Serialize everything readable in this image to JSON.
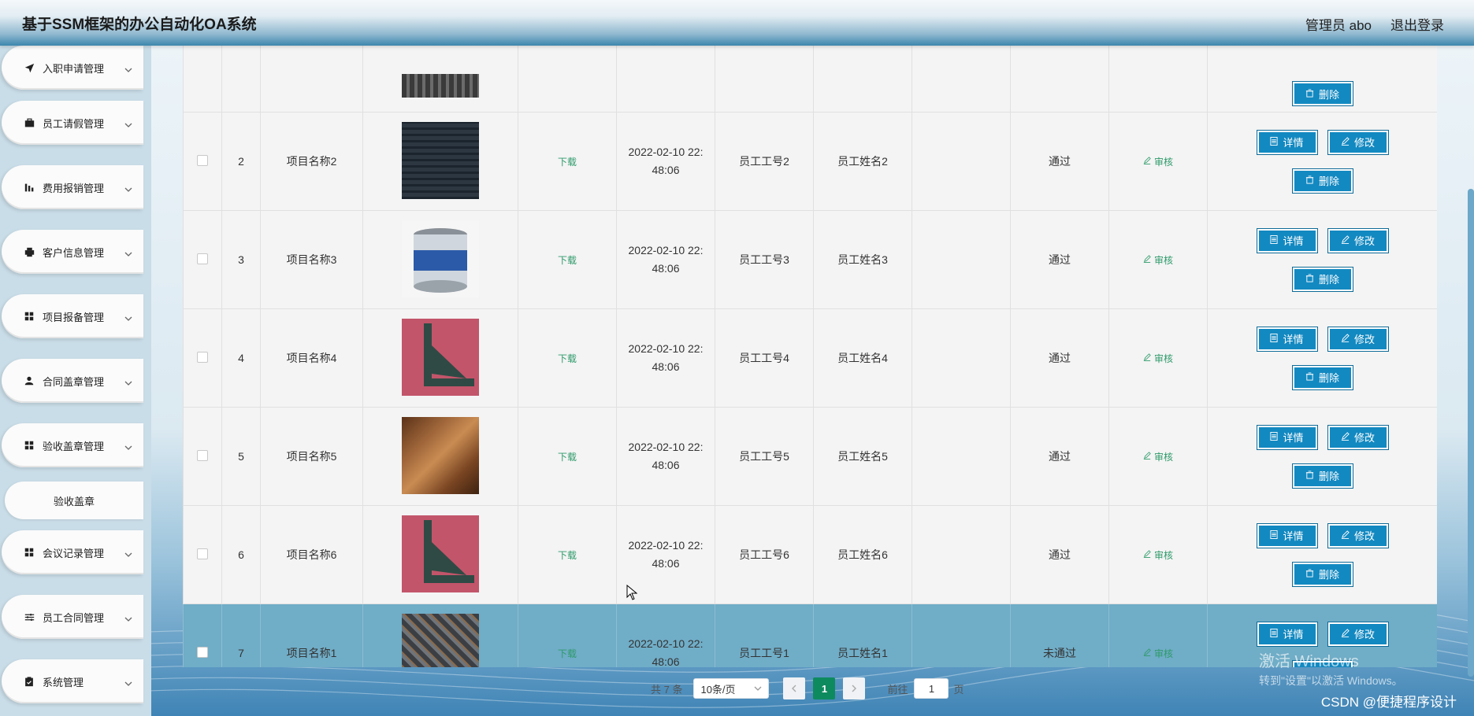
{
  "header": {
    "title": "基于SSM框架的办公自动化OA系统",
    "user": "管理员 abo",
    "logout": "退出登录"
  },
  "sidebar": {
    "items": [
      {
        "label": "入职申请管理",
        "icon": "send-icon"
      },
      {
        "label": "员工请假管理",
        "icon": "briefcase-icon"
      },
      {
        "label": "费用报销管理",
        "icon": "bar-chart-icon"
      },
      {
        "label": "客户信息管理",
        "icon": "printer-icon"
      },
      {
        "label": "项目报备管理",
        "icon": "grid-icon"
      },
      {
        "label": "合同盖章管理",
        "icon": "user-icon"
      },
      {
        "label": "验收盖章管理",
        "icon": "grid-icon"
      },
      {
        "label": "会议记录管理",
        "icon": "grid-icon"
      },
      {
        "label": "员工合同管理",
        "icon": "sliders-icon"
      },
      {
        "label": "系统管理",
        "icon": "clipboard-icon"
      }
    ],
    "sub_item": "验收盖章"
  },
  "table": {
    "download_label": "下载",
    "audit_label": "审核",
    "buttons": {
      "detail": "详情",
      "edit": "修改",
      "delete": "删除"
    },
    "rows": [
      {
        "index": "2",
        "project": "项目名称2",
        "image": "wire-mesh",
        "ts1": "2022-02-10 22:",
        "ts2": "48:06",
        "emp_no": "员工工号2",
        "emp_name": "员工姓名2",
        "status": "通过"
      },
      {
        "index": "3",
        "project": "项目名称3",
        "image": "paint-bucket",
        "ts1": "2022-02-10 22:",
        "ts2": "48:06",
        "emp_no": "员工工号3",
        "emp_name": "员工姓名3",
        "status": "通过"
      },
      {
        "index": "4",
        "project": "项目名称4",
        "image": "steel-angle",
        "ts1": "2022-02-10 22:",
        "ts2": "48:06",
        "emp_no": "员工工号4",
        "emp_name": "员工姓名4",
        "status": "通过"
      },
      {
        "index": "5",
        "project": "项目名称5",
        "image": "wood-boards",
        "ts1": "2022-02-10 22:",
        "ts2": "48:06",
        "emp_no": "员工工号5",
        "emp_name": "员工姓名5",
        "status": "通过"
      },
      {
        "index": "6",
        "project": "项目名称6",
        "image": "steel-angle",
        "ts1": "2022-02-10 22:",
        "ts2": "48:06",
        "emp_no": "员工工号6",
        "emp_name": "员工姓名6",
        "status": "通过"
      },
      {
        "index": "7",
        "project": "项目名称1",
        "image": "steel-bars",
        "ts1": "2022-02-10 22:",
        "ts2": "48:06",
        "emp_no": "员工工号1",
        "emp_name": "员工姓名1",
        "status": "未通过"
      }
    ]
  },
  "pagination": {
    "total": "共 7 条",
    "page_size": "10条/页",
    "current": "1",
    "goto_label": "前往",
    "goto_value": "1",
    "page_suffix": "页"
  },
  "overlay": {
    "activate_title": "激活 Windows",
    "activate_sub": "转到\"设置\"以激活 Windows。",
    "csdn": "CSDN @便捷程序设计"
  },
  "colors": {
    "accent": "#1389c1",
    "highlight_row": "#70adc7",
    "success_green": "#2e9a6a",
    "page_active": "#0e8a5f"
  }
}
